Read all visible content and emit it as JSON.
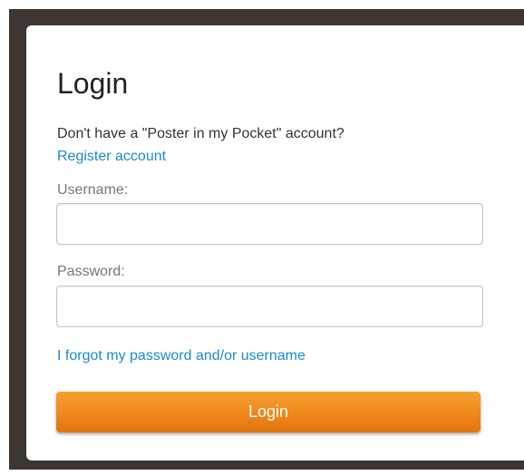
{
  "login": {
    "title": "Login",
    "intro_text": "Don't have a \"Poster in my Pocket\" account?",
    "register_link": "Register account",
    "username_label": "Username:",
    "username_value": "",
    "password_label": "Password:",
    "password_value": "",
    "forgot_link": "I forgot my password and/or username",
    "submit_label": "Login"
  },
  "colors": {
    "backdrop": "#3d3531",
    "link": "#1a8ccf",
    "button_top": "#f5a030",
    "button_bottom": "#e27410",
    "button_text": "#ffffff"
  }
}
